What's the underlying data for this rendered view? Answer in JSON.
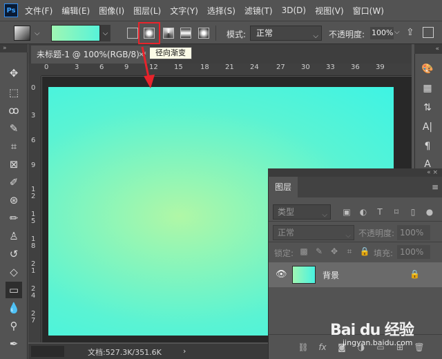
{
  "menu": {
    "logo": "Ps",
    "items": [
      "文件(F)",
      "编辑(E)",
      "图像(I)",
      "图层(L)",
      "文字(Y)",
      "选择(S)",
      "滤镜(T)",
      "3D(D)",
      "视图(V)",
      "窗口(W)"
    ]
  },
  "options": {
    "mode_label": "模式:",
    "mode_value": "正常",
    "opacity_label": "不透明度:",
    "opacity_value": "100%"
  },
  "tooltip": "径向渐变",
  "document": {
    "tab_title": "未标题-1 @ 100%(RGB/8) *",
    "close": "×"
  },
  "ruler": {
    "h_ticks": [
      "0",
      "3",
      "6",
      "9",
      "12",
      "15",
      "18",
      "21",
      "24",
      "27",
      "30",
      "33",
      "36",
      "39"
    ],
    "v_ticks": [
      "0",
      "3",
      "6",
      "9",
      "1\n2",
      "1\n5",
      "1\n8",
      "2\n1",
      "2\n4",
      "2\n7"
    ]
  },
  "layers_panel": {
    "tab": "图层",
    "filter_label": "类型",
    "blend_mode": "正常",
    "opacity_label": "不透明度:",
    "opacity_value": "100%",
    "lock_label": "锁定:",
    "fill_label": "填充:",
    "fill_value": "100%",
    "layer_name": "背景"
  },
  "status": {
    "text": "文档:527.3K/351.6K",
    "arrow": "›"
  },
  "watermark": {
    "main": "Bai du 经验",
    "sub": "jingyan.baidu.com"
  },
  "colors": {
    "accent_highlight": "#e8232b",
    "gradient_start": "#b0f7a6",
    "gradient_end": "#3ef3e4"
  }
}
